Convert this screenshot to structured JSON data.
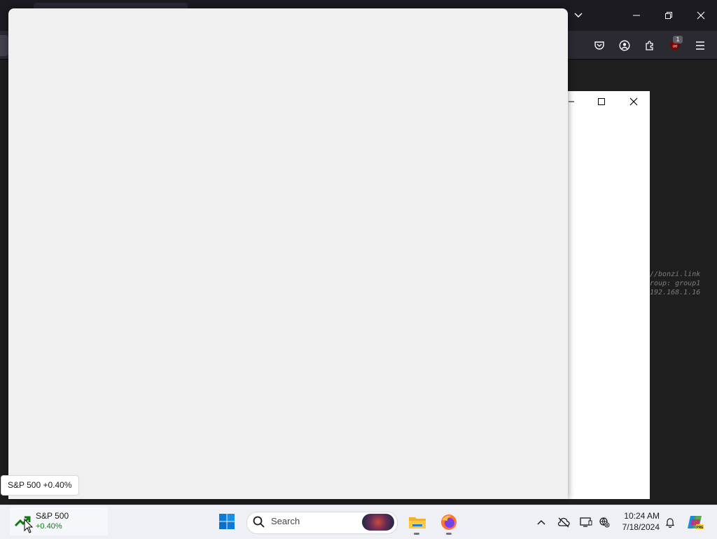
{
  "browser": {
    "tab_badge_count": "1",
    "code_lines": [
      "//bonzi.link",
      "roup: group1",
      "192.168.1.16"
    ]
  },
  "icons": {
    "tab_list": "chevron-down-icon",
    "minimize": "minimize-icon",
    "restore": "restore-icon",
    "close": "close-icon",
    "pocket": "pocket-icon",
    "account": "account-icon",
    "extensions": "puzzle-icon",
    "ublock": "ublock-icon",
    "menu": "hamburger-menu-icon"
  },
  "tooltip": {
    "text": "S&P 500 +0.40%"
  },
  "taskbar": {
    "widget": {
      "title": "S&P 500",
      "value": "+0.40%"
    },
    "search_placeholder": "Search",
    "clock": {
      "time": "10:24 AM",
      "date": "7/18/2024"
    }
  },
  "colors": {
    "positive": "#0f7b0f",
    "windows_blue": "#0a7bd8",
    "chrome_dark": "#1c1b22",
    "toolbar_dark": "#2b2a33",
    "window_bg": "#f0f0f0"
  }
}
